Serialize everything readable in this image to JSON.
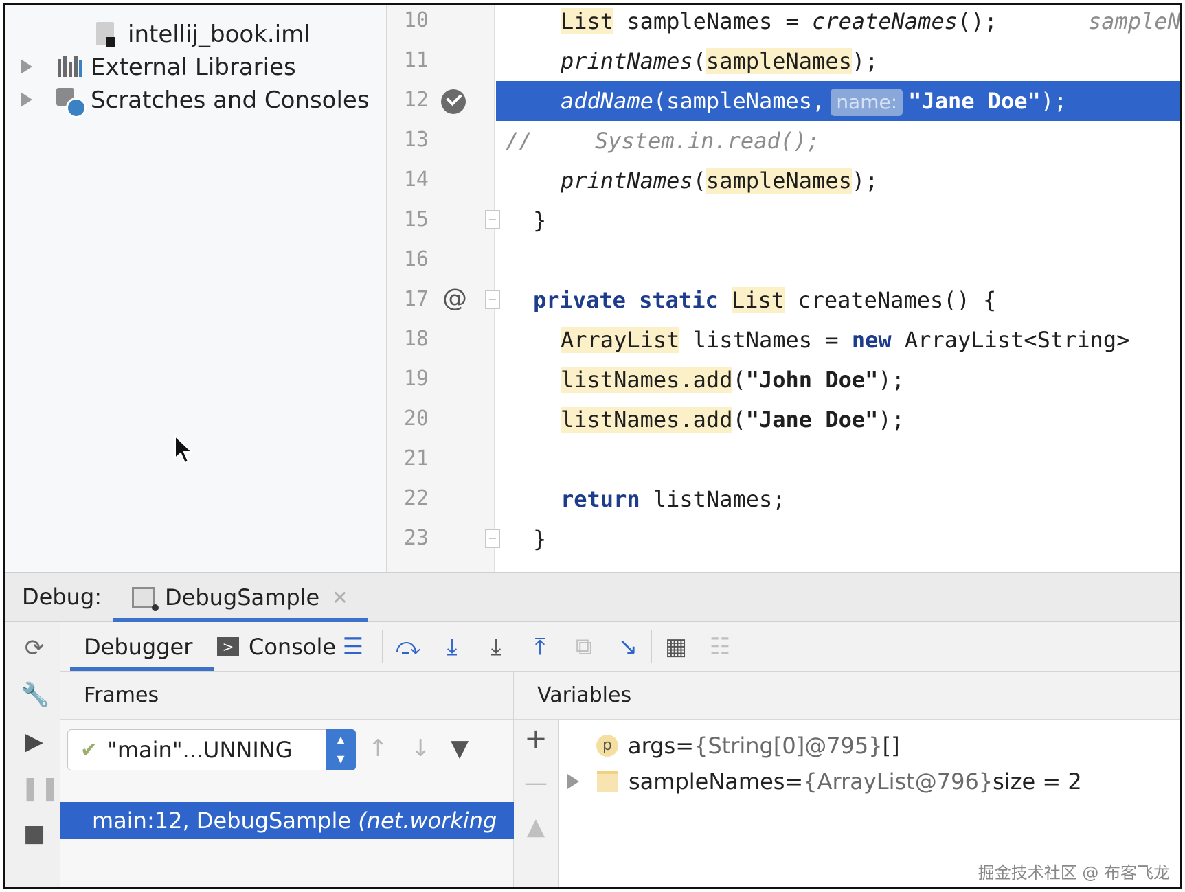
{
  "project_tree": {
    "items": [
      {
        "label": "intellij_book.iml",
        "icon": "file-icon"
      },
      {
        "label": "External Libraries",
        "icon": "library-icon"
      },
      {
        "label": "Scratches and Consoles",
        "icon": "scratches-icon"
      }
    ]
  },
  "editor": {
    "lines": [
      {
        "num": "10"
      },
      {
        "num": "11"
      },
      {
        "num": "12"
      },
      {
        "num": "13"
      },
      {
        "num": "14"
      },
      {
        "num": "15"
      },
      {
        "num": "16"
      },
      {
        "num": "17"
      },
      {
        "num": "18"
      },
      {
        "num": "19"
      },
      {
        "num": "20"
      },
      {
        "num": "21"
      },
      {
        "num": "22"
      },
      {
        "num": "23"
      }
    ],
    "code": {
      "l10_type": "List",
      "l10_rest": " sampleNames = ",
      "l10_call": "createNames",
      "l10_end": "();",
      "l10_hint": "sampleN",
      "l11_call": "printNames",
      "l11_arg": "sampleNames",
      "l11_end": ");",
      "l12_call": "addName",
      "l12_arg": "(sampleNames,",
      "l12_hint": "name:",
      "l12_str": "\"Jane Doe\"",
      "l12_end": ");",
      "l13_comment": "//",
      "l13_code": "System.in.read();",
      "l14_call": "printNames",
      "l14_arg": "sampleNames",
      "l14_end": ");",
      "l15": "}",
      "l17_kw1": "private",
      "l17_kw2": "static",
      "l17_type": "List",
      "l17_rest": " createNames() {",
      "l18_type": "ArrayList",
      "l18_mid": " listNames = ",
      "l18_kw": "new",
      "l18_rest": " ArrayList<String>",
      "l19_obj": "listNames.add",
      "l19_open": "(",
      "l19_str": "\"John Doe\"",
      "l19_end": ");",
      "l20_obj": "listNames.add",
      "l20_open": "(",
      "l20_str": "\"Jane Doe\"",
      "l20_end": ");",
      "l22_kw": "return",
      "l22_rest": " listNames;",
      "l23": "}"
    },
    "gutter_icons": {
      "line12": "breakpoint-check-icon",
      "line17": "annotation-at-icon"
    }
  },
  "debug": {
    "label": "Debug:",
    "session_tab": "DebugSample",
    "sub_tabs": [
      "Debugger",
      "Console"
    ],
    "frames_header": "Frames",
    "variables_header": "Variables",
    "thread": "\"main\"...UNNING",
    "frame_row": "main:12, DebugSample",
    "frame_row_pkg": "(net.working",
    "variables": [
      {
        "name": "args",
        "eq": " = ",
        "value": "{String[0]@795}",
        "extra": " []",
        "icon": "param-icon"
      },
      {
        "name": "sampleNames",
        "eq": " = ",
        "value": "{ArrayList@796}",
        "extra": " size = 2",
        "icon": "field-icon"
      }
    ],
    "watermark": "掘金技术社区 @ 布客飞龙"
  },
  "colors": {
    "selection": "#2f65ca",
    "accent": "#3b71c9",
    "highlight": "#fbf0c7",
    "keyword": "#1e3c8c"
  }
}
